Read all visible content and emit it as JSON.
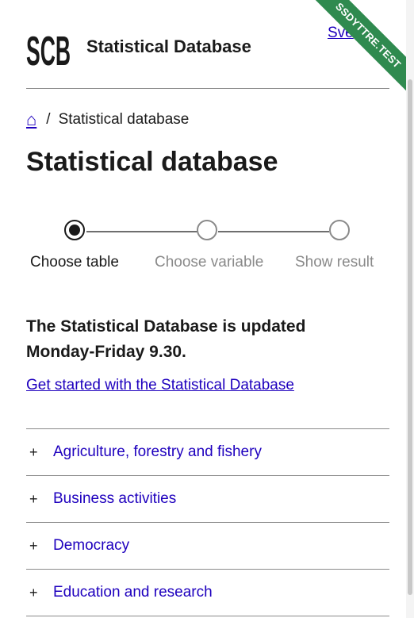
{
  "header": {
    "logo_text": "SCB",
    "site_title": "Statistical Database",
    "lang_link": "Sve",
    "ribbon": "SSDYTTRE.TEST"
  },
  "breadcrumb": {
    "home_icon": "home-icon",
    "separator": "/",
    "current": "Statistical database"
  },
  "page_title": "Statistical database",
  "stepper": {
    "steps": [
      {
        "label": "Choose table",
        "state": "active"
      },
      {
        "label": "Choose variable",
        "state": "inactive"
      },
      {
        "label": "Show result",
        "state": "inactive"
      }
    ]
  },
  "notice": "The Statistical Database is updated Monday-Friday 9.30.",
  "get_started_link": "Get started with the Statistical Database",
  "accordion": {
    "expand_symbol": "+",
    "items": [
      {
        "label": "Agriculture, forestry and fishery"
      },
      {
        "label": "Business activities"
      },
      {
        "label": "Democracy"
      },
      {
        "label": "Education and research"
      }
    ]
  },
  "colors": {
    "link": "#1e00be",
    "ribbon": "#2f8a4f",
    "text": "#1a1a1a",
    "inactive": "#8a8a8a"
  }
}
